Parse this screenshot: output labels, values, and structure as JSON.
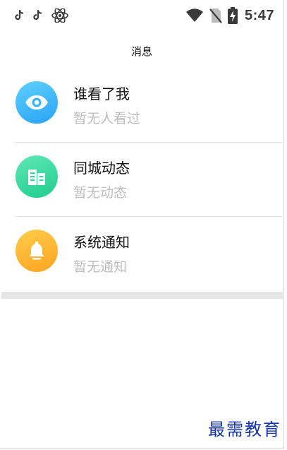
{
  "status_bar": {
    "left_icons": [
      "tiktok-icon",
      "tiktok-icon",
      "atom-icon"
    ],
    "right_icons": [
      "wifi-icon",
      "no-sim-icon",
      "battery-charging-icon"
    ],
    "time": "5:47"
  },
  "header": {
    "title": "消息"
  },
  "messages": [
    {
      "icon": "eye-icon",
      "color": "#35b4fa",
      "title": "谁看了我",
      "subtitle": "暂无人看过"
    },
    {
      "icon": "building-icon",
      "color": "#2ed69a",
      "title": "同城动态",
      "subtitle": "暂无动态"
    },
    {
      "icon": "bell-icon",
      "color": "#ffb52e",
      "title": "系统通知",
      "subtitle": "暂无通知"
    }
  ],
  "watermark": "最需教育"
}
